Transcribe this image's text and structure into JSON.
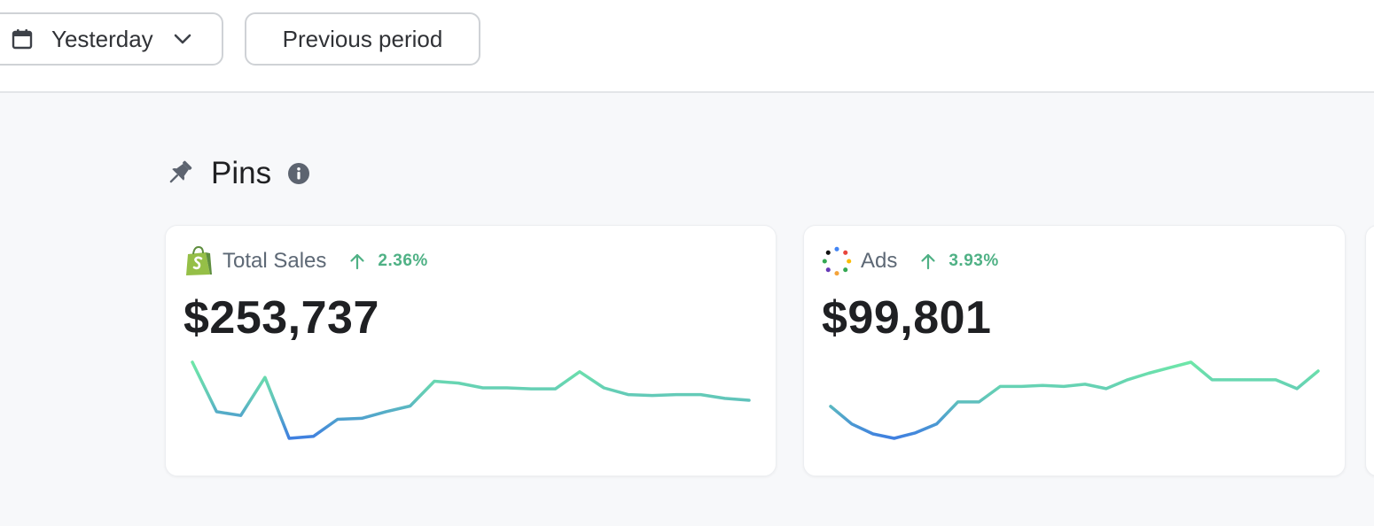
{
  "toolbar": {
    "date_range_label": "Yesterday",
    "compare_label": "Previous period"
  },
  "section": {
    "title": "Pins"
  },
  "cards": [
    {
      "title": "Total Sales",
      "delta": "2.36%",
      "value": "$253,737",
      "logo": "shopify-bag-icon",
      "sparkline": [
        100,
        74,
        72,
        92,
        60,
        61,
        70,
        70.5,
        74,
        77,
        90,
        89,
        86.5,
        86.5,
        86,
        86,
        95,
        86.5,
        83,
        82.5,
        83,
        83,
        81,
        80
      ]
    },
    {
      "title": "Ads",
      "delta": "3.93%",
      "value": "$99,801",
      "logo": "ads-dots-icon",
      "sparkline": [
        71,
        63,
        58.5,
        56.5,
        59,
        63,
        73,
        73,
        80,
        80,
        80.5,
        80,
        81,
        79,
        83,
        86,
        88.5,
        91,
        83,
        83,
        83,
        83,
        79,
        87
      ]
    }
  ],
  "colors": {
    "accent_positive": "#4fb185",
    "spark_low": "#3f7fe0",
    "spark_high": "#6ee7a8"
  }
}
